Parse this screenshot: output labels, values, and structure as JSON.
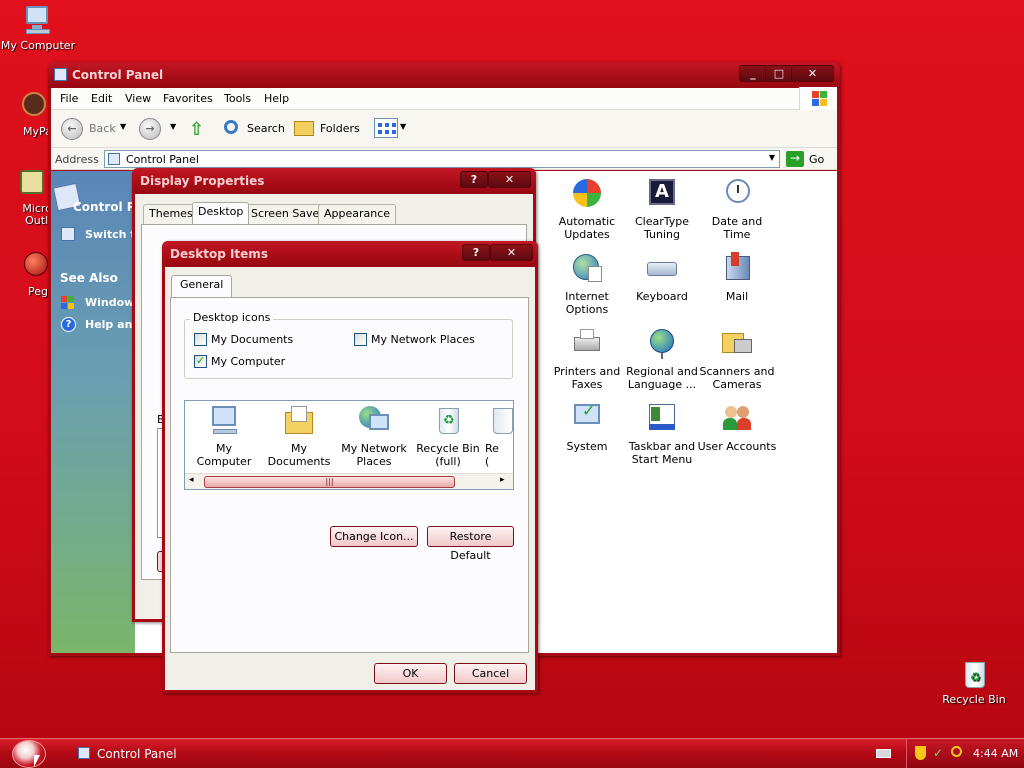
{
  "desktop": {
    "icons": [
      {
        "label": "My Computer",
        "icon": "my-computer-icon"
      },
      {
        "label": "MyPal",
        "icon": "mypal-icon"
      },
      {
        "label": "Micros Outlo",
        "icon": "outlook-icon"
      },
      {
        "label": "Peg",
        "icon": "pegasus-icon"
      },
      {
        "label": "Recycle Bin",
        "icon": "recycle-bin-icon"
      }
    ]
  },
  "control_panel": {
    "title": "Control Panel",
    "window_buttons": [
      "_",
      "□",
      "✕"
    ],
    "menu": [
      "File",
      "Edit",
      "View",
      "Favorites",
      "Tools",
      "Help"
    ],
    "toolbar": {
      "back": "Back",
      "search": "Search",
      "folders": "Folders"
    },
    "address_label": "Address",
    "address_value": "Control Panel",
    "go_label": "Go",
    "side": {
      "header": "Control Pan",
      "switch": "Switch to",
      "see_also": "See Also",
      "links": [
        "Windows",
        "Help and"
      ]
    },
    "items": [
      {
        "label": "ve",
        "icon": "partial-icon"
      },
      {
        "label": "Automatic Updates",
        "icon": "automatic-updates-icon"
      },
      {
        "label": "ClearType Tuning",
        "icon": "cleartype-icon"
      },
      {
        "label": "Date and Time",
        "icon": "date-time-icon"
      },
      {
        "label": "Internet Options",
        "icon": "internet-options-icon"
      },
      {
        "label": "Keyboard",
        "icon": "keyboard-icon"
      },
      {
        "label": "Mail",
        "icon": "mail-icon"
      },
      {
        "label": "ns",
        "icon": "partial-icon"
      },
      {
        "label": "Printers and Faxes",
        "icon": "printers-icon"
      },
      {
        "label": "Regional and Language ...",
        "icon": "regional-icon"
      },
      {
        "label": "Scanners and Cameras",
        "icon": "scanners-icon"
      },
      {
        "label": "System",
        "icon": "system-icon"
      },
      {
        "label": "Taskbar and Start Menu",
        "icon": "taskbar-icon"
      },
      {
        "label": "User Accounts",
        "icon": "user-accounts-icon"
      }
    ]
  },
  "display_properties": {
    "title": "Display Properties",
    "tabs": [
      "Themes",
      "Desktop",
      "Screen Saver",
      "Appearance"
    ],
    "active_tab": "Desktop",
    "partial_label": "B"
  },
  "desktop_items": {
    "title": "Desktop Items",
    "tab": "General",
    "group_label": "Desktop icons",
    "checkboxes": [
      {
        "label": "My Documents",
        "checked": false
      },
      {
        "label": "My Network Places",
        "checked": false
      },
      {
        "label": "My Computer",
        "checked": true
      }
    ],
    "icons": [
      {
        "label": "My Computer",
        "icon": "my-computer-icon"
      },
      {
        "label": "My Documents",
        "icon": "my-documents-icon"
      },
      {
        "label": "My Network Places",
        "icon": "network-places-icon"
      },
      {
        "label": "Recycle Bin (full)",
        "icon": "recycle-bin-full-icon"
      },
      {
        "label": "Re (",
        "icon": "recycle-bin-empty-icon"
      }
    ],
    "change_icon": "Change Icon...",
    "restore_default": "Restore Default",
    "ok": "OK",
    "cancel": "Cancel"
  },
  "taskbar": {
    "task": "Control Panel",
    "clock": "4:44 AM"
  },
  "colors": {
    "accent": "#c8101c",
    "desktop": "#d20c1a"
  }
}
